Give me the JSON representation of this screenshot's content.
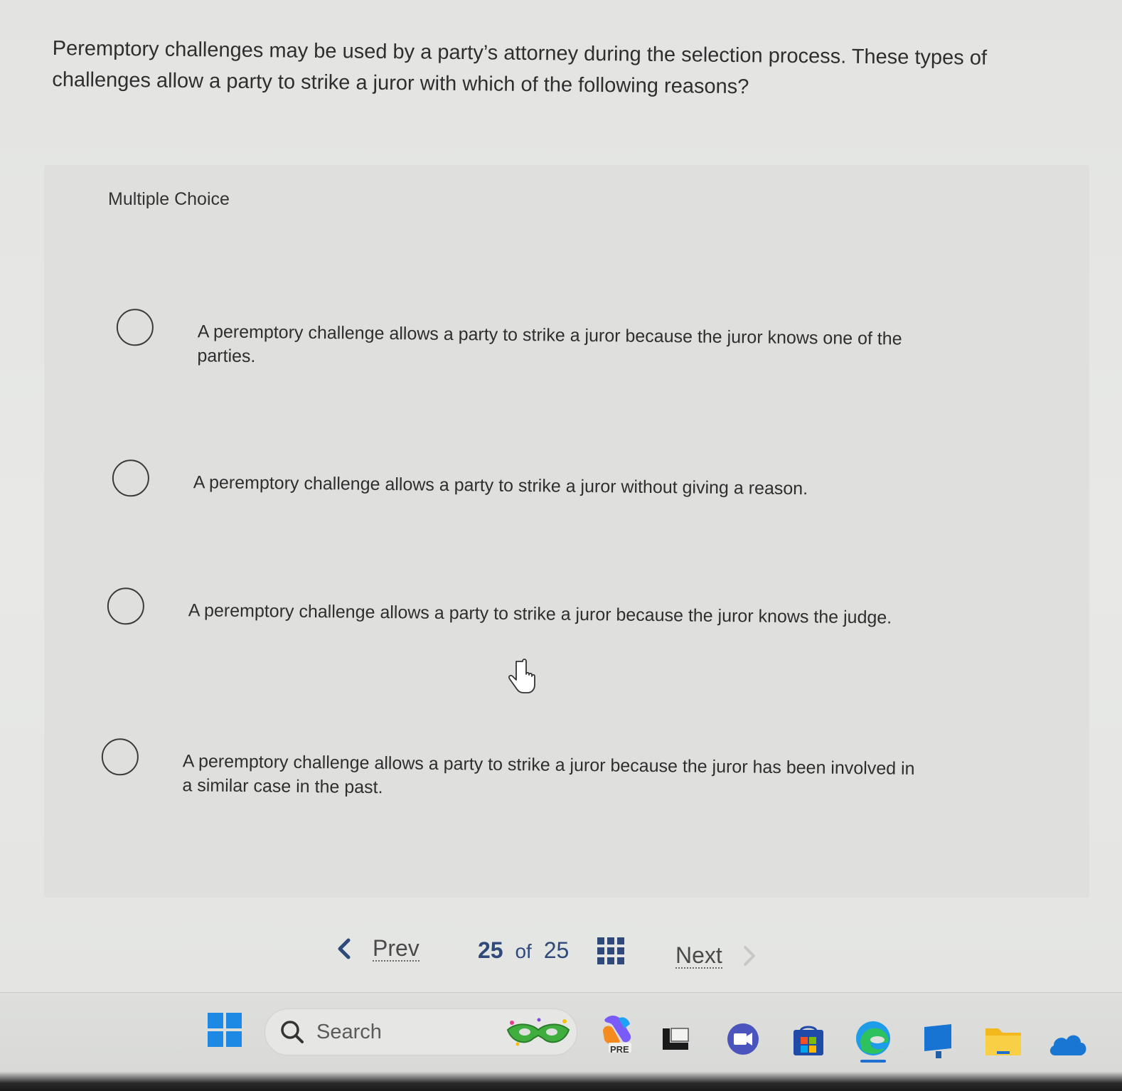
{
  "question": {
    "text": "Peremptory challenges may be used by a party’s attorney during the selection process. These types of challenges allow a party to strike a juror with which of the following reasons?"
  },
  "multiple_choice": {
    "label": "Multiple Choice",
    "options": [
      {
        "text": "A peremptory challenge allows a party to strike a juror because the juror knows one of the parties."
      },
      {
        "text": "A peremptory challenge allows a party to strike a juror without giving a reason."
      },
      {
        "text": "A peremptory challenge allows a party to strike a juror because the juror knows the judge."
      },
      {
        "text": "A peremptory challenge allows a party to strike a juror because the juror has been involved in a similar case in the past."
      }
    ]
  },
  "navigation": {
    "prev_label": "Prev",
    "current": "25",
    "of": "of",
    "total": "25",
    "next_label": "Next",
    "accent_color": "#2f4a7a"
  },
  "taskbar": {
    "search_label": "Search",
    "icons": [
      "windows-start-icon",
      "search-icon",
      "mask-widget-icon",
      "copilot-pre-icon",
      "task-view-icon",
      "teams-icon",
      "store-icon",
      "edge-icon",
      "monitor-app-icon",
      "file-explorer-icon",
      "onedrive-icon"
    ],
    "pre_badge": "PRE"
  }
}
